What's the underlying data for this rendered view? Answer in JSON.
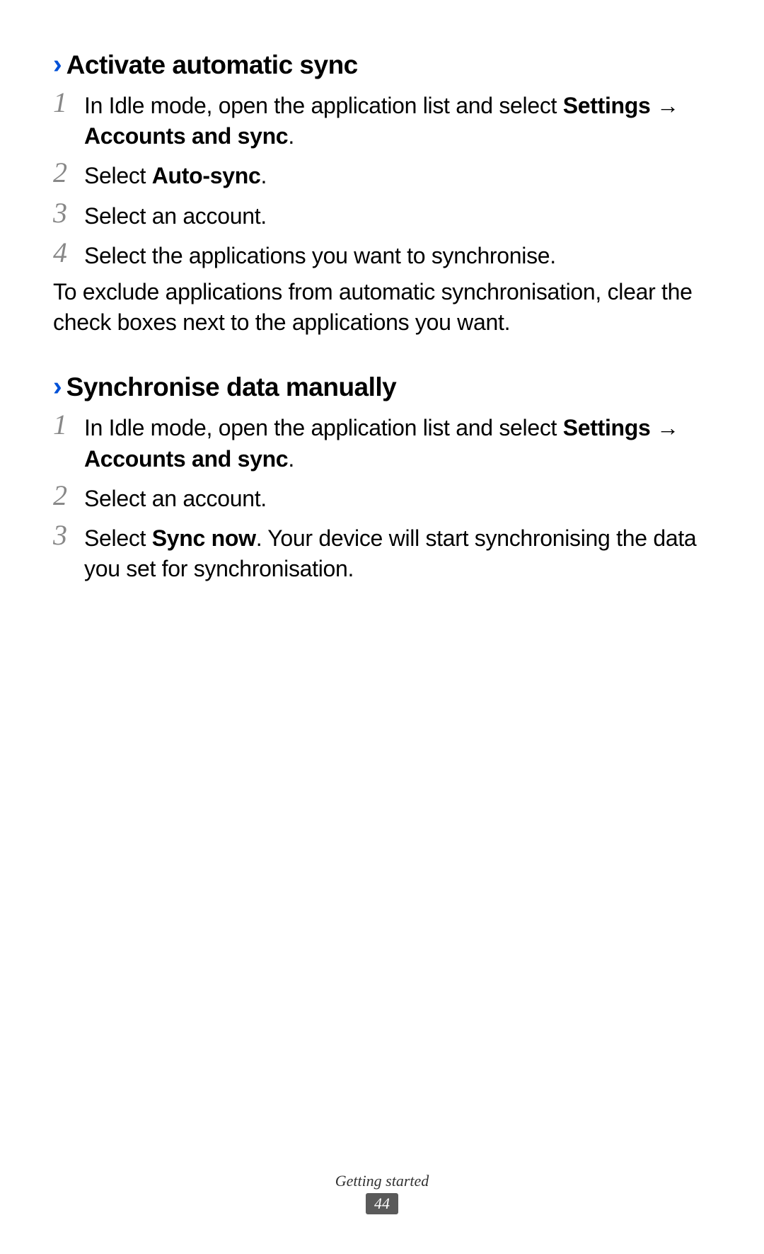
{
  "section1": {
    "heading": "Activate automatic sync",
    "steps": [
      {
        "num": "1",
        "pre": "In Idle mode, open the application list and select ",
        "bold1": "Settings",
        "mid": " → ",
        "bold2": "Accounts and sync",
        "post": "."
      },
      {
        "num": "2",
        "pre": "Select ",
        "bold1": "Auto-sync",
        "post": "."
      },
      {
        "num": "3",
        "pre": "Select an account."
      },
      {
        "num": "4",
        "pre": "Select the applications you want to synchronise."
      }
    ],
    "note": "To exclude applications from automatic synchronisation, clear the check boxes next to the applications you want."
  },
  "section2": {
    "heading": "Synchronise data manually",
    "steps": [
      {
        "num": "1",
        "pre": "In Idle mode, open the application list and select ",
        "bold1": "Settings",
        "mid": " → ",
        "bold2": "Accounts and sync",
        "post": "."
      },
      {
        "num": "2",
        "pre": "Select an account."
      },
      {
        "num": "3",
        "pre": "Select ",
        "bold1": "Sync now",
        "post": ". Your device will start synchronising the data you set for synchronisation."
      }
    ]
  },
  "footer": {
    "label": "Getting started",
    "page": "44"
  },
  "chevron": "›"
}
